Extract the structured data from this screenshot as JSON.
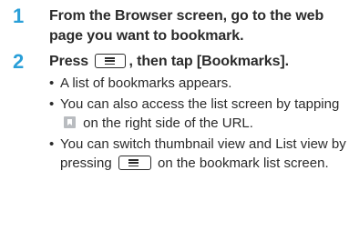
{
  "steps": [
    {
      "number": "1",
      "title": "From the Browser screen, go to the web page you want to bookmark."
    },
    {
      "number": "2",
      "title_before": "Press ",
      "title_after": ", then tap [Bookmarks].",
      "bullets": [
        {
          "text": "A list of bookmarks appears."
        },
        {
          "text_before": "You can also access the list screen by tapping ",
          "text_after": " on the right side of the URL."
        },
        {
          "text_before": "You can switch thumbnail view and List view by pressing ",
          "text_after": " on the bookmark list screen."
        }
      ]
    }
  ],
  "bullet_char": "•",
  "icons": {
    "menu_key": "menu-key-icon",
    "bookmark": "bookmark-icon"
  },
  "colors": {
    "step_number": "#2a9fd8",
    "text": "#2b2b2b",
    "bookmark_icon": "#b9bcc0"
  }
}
